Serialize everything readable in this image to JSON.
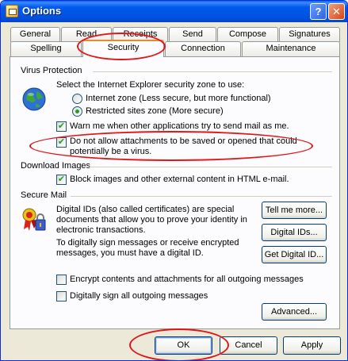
{
  "window": {
    "title": "Options"
  },
  "tabs_row1": [
    {
      "label": "General"
    },
    {
      "label": "Read"
    },
    {
      "label": "Receipts"
    },
    {
      "label": "Send"
    },
    {
      "label": "Compose"
    },
    {
      "label": "Signatures"
    }
  ],
  "tabs_row2": [
    {
      "label": "Spelling"
    },
    {
      "label": "Security"
    },
    {
      "label": "Connection"
    },
    {
      "label": "Maintenance"
    }
  ],
  "virus": {
    "heading": "Virus Protection",
    "zone_prompt": "Select the Internet Explorer security zone to use:",
    "internet_zone": "Internet zone (Less secure, but more functional)",
    "restricted_zone": "Restricted sites zone (More secure)",
    "warn_label": "Warn me when other applications try to send mail as me.",
    "attach_line1": "Do not allow attachments to be saved or opened that could",
    "attach_line2": "potentially be a virus."
  },
  "download": {
    "heading": "Download Images",
    "block_label": "Block images and other external content in HTML e-mail."
  },
  "secure": {
    "heading": "Secure Mail",
    "desc_line1": "Digital IDs (also called certificates) are special",
    "desc_line2": "documents that allow you to prove your identity in",
    "desc_line3": "electronic transactions.",
    "desc2_line1": "To digitally sign messages or receive encrypted",
    "desc2_line2": "messages, you must have a digital ID.",
    "tell_me_more": "Tell me more...",
    "digital_ids": "Digital IDs...",
    "get_digital_id": "Get Digital ID...",
    "encrypt_label": "Encrypt contents and attachments for all outgoing messages",
    "sign_label": "Digitally sign all outgoing messages",
    "advanced": "Advanced..."
  },
  "footer": {
    "ok": "OK",
    "cancel": "Cancel",
    "apply": "Apply"
  },
  "icons": {
    "window": "options-window-icon",
    "globe": "globe-icon",
    "certificate": "certificate-icon",
    "help": "help-icon",
    "close": "close-icon"
  },
  "colors": {
    "titlebar": "#0054e3",
    "dialog_bg": "#ece9d8",
    "annotation": "#e0161b",
    "check_mark": "#21a121"
  }
}
